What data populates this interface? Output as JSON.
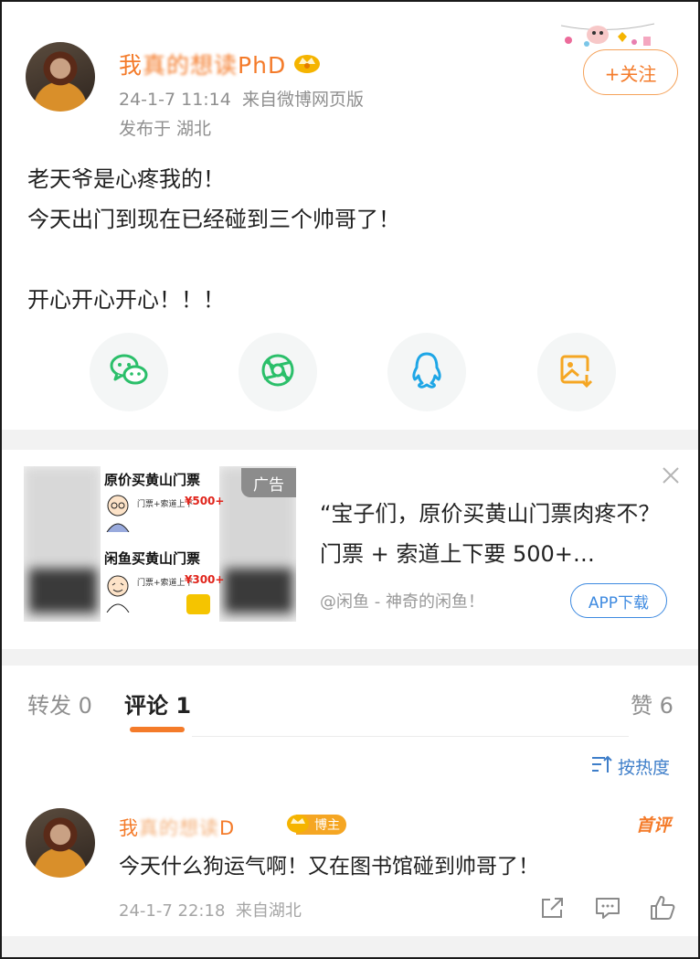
{
  "post": {
    "username_visible": "我",
    "username_blurred": "真的想读",
    "username_suffix": "PhD",
    "timestamp": "24-1-7 11:14",
    "source": "来自微博网页版",
    "location": "发布于 湖北",
    "follow_label": "+关注",
    "body_lines": [
      "老天爷是心疼我的！",
      "今天出门到现在已经碰到三个帅哥了！",
      "",
      "开心开心开心！！！"
    ],
    "share_icons": [
      "wechat-icon",
      "moments-icon",
      "qq-icon",
      "save-image-icon"
    ]
  },
  "ad": {
    "tag": "广告",
    "text": "“宝子们，原价买黄山门票肉疼不？门票 + 索道上下要 500+…",
    "source": "@闲鱼 - 神奇的闲鱼！",
    "download_label": "APP下载",
    "image": {
      "top_title": "原价买黄山门票",
      "top_caption": "门票+索道上下",
      "top_price": "¥500+",
      "bottom_title": "闲鱼买黄山门票",
      "bottom_caption": "门票+索道上下",
      "bottom_price": "¥300+"
    }
  },
  "tabs": {
    "repost": "转发 0",
    "comments": "评论 1",
    "likes": "赞 6",
    "sort": "按热度"
  },
  "comment": {
    "name_visible": "我",
    "name_blurred": "真的想读",
    "name_suffix": "D",
    "badge": "博主",
    "first_tag": "首评",
    "text": "今天什么狗运气啊！又在图书馆碰到帅哥了！",
    "timestamp": "24-1-7 22:18",
    "location": "来自湖北"
  },
  "colors": {
    "accent_orange": "#f47b2a",
    "link_blue": "#3e8ae0",
    "meta_gray": "#8f8f8f",
    "wechat_green": "#2bbf6a",
    "qq_blue": "#1ea6e6",
    "save_orange": "#f5a623"
  }
}
